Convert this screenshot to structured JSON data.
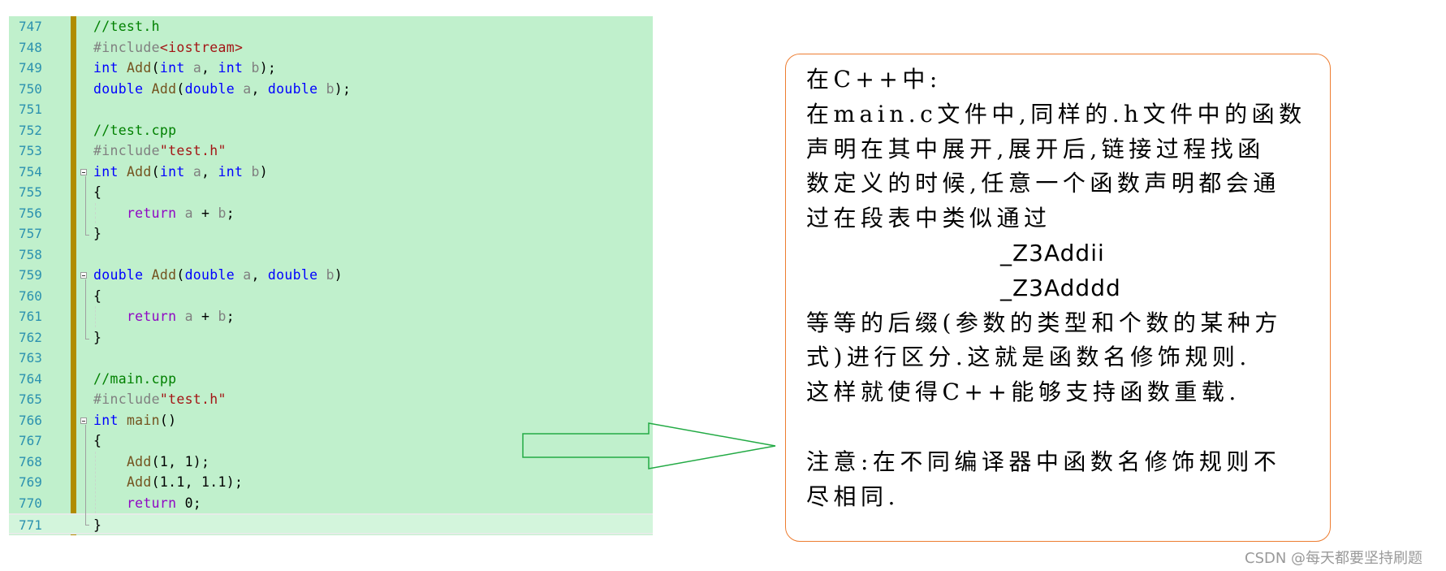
{
  "editor": {
    "lines": [
      {
        "num": "747",
        "segments": [
          {
            "t": "//test.h",
            "c": "cm"
          }
        ]
      },
      {
        "num": "748",
        "segments": [
          {
            "t": "#include",
            "c": "pp"
          },
          {
            "t": "<iostream>",
            "c": "inc"
          }
        ]
      },
      {
        "num": "749",
        "segments": [
          {
            "t": "int",
            "c": "kw"
          },
          {
            "t": " "
          },
          {
            "t": "Add",
            "c": "fn"
          },
          {
            "t": "("
          },
          {
            "t": "int",
            "c": "kw"
          },
          {
            "t": " "
          },
          {
            "t": "a",
            "c": "pr"
          },
          {
            "t": ", "
          },
          {
            "t": "int",
            "c": "kw"
          },
          {
            "t": " "
          },
          {
            "t": "b",
            "c": "pr"
          },
          {
            "t": ");"
          }
        ]
      },
      {
        "num": "750",
        "segments": [
          {
            "t": "double",
            "c": "kw"
          },
          {
            "t": " "
          },
          {
            "t": "Add",
            "c": "fn"
          },
          {
            "t": "("
          },
          {
            "t": "double",
            "c": "kw"
          },
          {
            "t": " "
          },
          {
            "t": "a",
            "c": "pr"
          },
          {
            "t": ", "
          },
          {
            "t": "double",
            "c": "kw"
          },
          {
            "t": " "
          },
          {
            "t": "b",
            "c": "pr"
          },
          {
            "t": ");"
          }
        ]
      },
      {
        "num": "751",
        "segments": []
      },
      {
        "num": "752",
        "segments": [
          {
            "t": "//test.cpp",
            "c": "cm"
          }
        ]
      },
      {
        "num": "753",
        "segments": [
          {
            "t": "#include",
            "c": "pp"
          },
          {
            "t": "\"test.h\"",
            "c": "inc"
          }
        ]
      },
      {
        "num": "754",
        "fold": true,
        "segments": [
          {
            "t": "int",
            "c": "kw"
          },
          {
            "t": " "
          },
          {
            "t": "Add",
            "c": "fn"
          },
          {
            "t": "("
          },
          {
            "t": "int",
            "c": "kw"
          },
          {
            "t": " "
          },
          {
            "t": "a",
            "c": "pr"
          },
          {
            "t": ", "
          },
          {
            "t": "int",
            "c": "kw"
          },
          {
            "t": " "
          },
          {
            "t": "b",
            "c": "pr"
          },
          {
            "t": ")"
          }
        ]
      },
      {
        "num": "755",
        "segments": [
          {
            "t": "{"
          }
        ]
      },
      {
        "num": "756",
        "segments": [
          {
            "t": "    "
          },
          {
            "t": "return",
            "c": "rt"
          },
          {
            "t": " "
          },
          {
            "t": "a",
            "c": "pr"
          },
          {
            "t": " + "
          },
          {
            "t": "b",
            "c": "pr"
          },
          {
            "t": ";"
          }
        ]
      },
      {
        "num": "757",
        "segments": [
          {
            "t": "}"
          }
        ]
      },
      {
        "num": "758",
        "segments": []
      },
      {
        "num": "759",
        "fold": true,
        "segments": [
          {
            "t": "double",
            "c": "kw"
          },
          {
            "t": " "
          },
          {
            "t": "Add",
            "c": "fn"
          },
          {
            "t": "("
          },
          {
            "t": "double",
            "c": "kw"
          },
          {
            "t": " "
          },
          {
            "t": "a",
            "c": "pr"
          },
          {
            "t": ", "
          },
          {
            "t": "double",
            "c": "kw"
          },
          {
            "t": " "
          },
          {
            "t": "b",
            "c": "pr"
          },
          {
            "t": ")"
          }
        ]
      },
      {
        "num": "760",
        "segments": [
          {
            "t": "{"
          }
        ]
      },
      {
        "num": "761",
        "segments": [
          {
            "t": "    "
          },
          {
            "t": "return",
            "c": "rt"
          },
          {
            "t": " "
          },
          {
            "t": "a",
            "c": "pr"
          },
          {
            "t": " + "
          },
          {
            "t": "b",
            "c": "pr"
          },
          {
            "t": ";"
          }
        ]
      },
      {
        "num": "762",
        "segments": [
          {
            "t": "}"
          }
        ]
      },
      {
        "num": "763",
        "segments": []
      },
      {
        "num": "764",
        "segments": [
          {
            "t": "//main.cpp",
            "c": "cm"
          }
        ]
      },
      {
        "num": "765",
        "segments": [
          {
            "t": "#include",
            "c": "pp"
          },
          {
            "t": "\"test.h\"",
            "c": "inc"
          }
        ]
      },
      {
        "num": "766",
        "fold": true,
        "segments": [
          {
            "t": "int",
            "c": "kw"
          },
          {
            "t": " "
          },
          {
            "t": "main",
            "c": "fn"
          },
          {
            "t": "()"
          }
        ]
      },
      {
        "num": "767",
        "segments": [
          {
            "t": "{"
          }
        ]
      },
      {
        "num": "768",
        "segments": [
          {
            "t": "    "
          },
          {
            "t": "Add",
            "c": "fn"
          },
          {
            "t": "(1, 1);"
          }
        ]
      },
      {
        "num": "769",
        "segments": [
          {
            "t": "    "
          },
          {
            "t": "Add",
            "c": "fn"
          },
          {
            "t": "(1.1, 1.1);"
          }
        ]
      },
      {
        "num": "770",
        "segments": [
          {
            "t": "    "
          },
          {
            "t": "return",
            "c": "rt"
          },
          {
            "t": " 0;"
          }
        ]
      },
      {
        "num": "771",
        "current": true,
        "segments": [
          {
            "t": "}"
          }
        ]
      }
    ]
  },
  "note": {
    "lines": [
      {
        "text": "在C++中:"
      },
      {
        "text": "在main.c文件中,同样的.h文件中的函数"
      },
      {
        "text": "声明在其中展开,展开后,链接过程找函"
      },
      {
        "text": "数定义的时候,任意一个函数声明都会通"
      },
      {
        "text": "过在段表中类似通过"
      },
      {
        "text": "_Z3Addii",
        "mangled": true
      },
      {
        "text": "_Z3Adddd",
        "mangled": true
      },
      {
        "text": "等等的后缀(参数的类型和个数的某种方"
      },
      {
        "text": "式)进行区分.这就是函数名修饰规则."
      },
      {
        "text": "这样就使得C++能够支持函数重载."
      },
      {
        "text": ""
      },
      {
        "text": "注意:在不同编译器中函数名修饰规则不"
      },
      {
        "text": "尽相同."
      }
    ]
  },
  "colors": {
    "editor_bg": "#c0f0cc",
    "change_bar": "#b08c00",
    "arrow_stroke": "#22aa44",
    "note_border": "#ed7d31"
  },
  "watermark": "CSDN @每天都要坚持刷题"
}
